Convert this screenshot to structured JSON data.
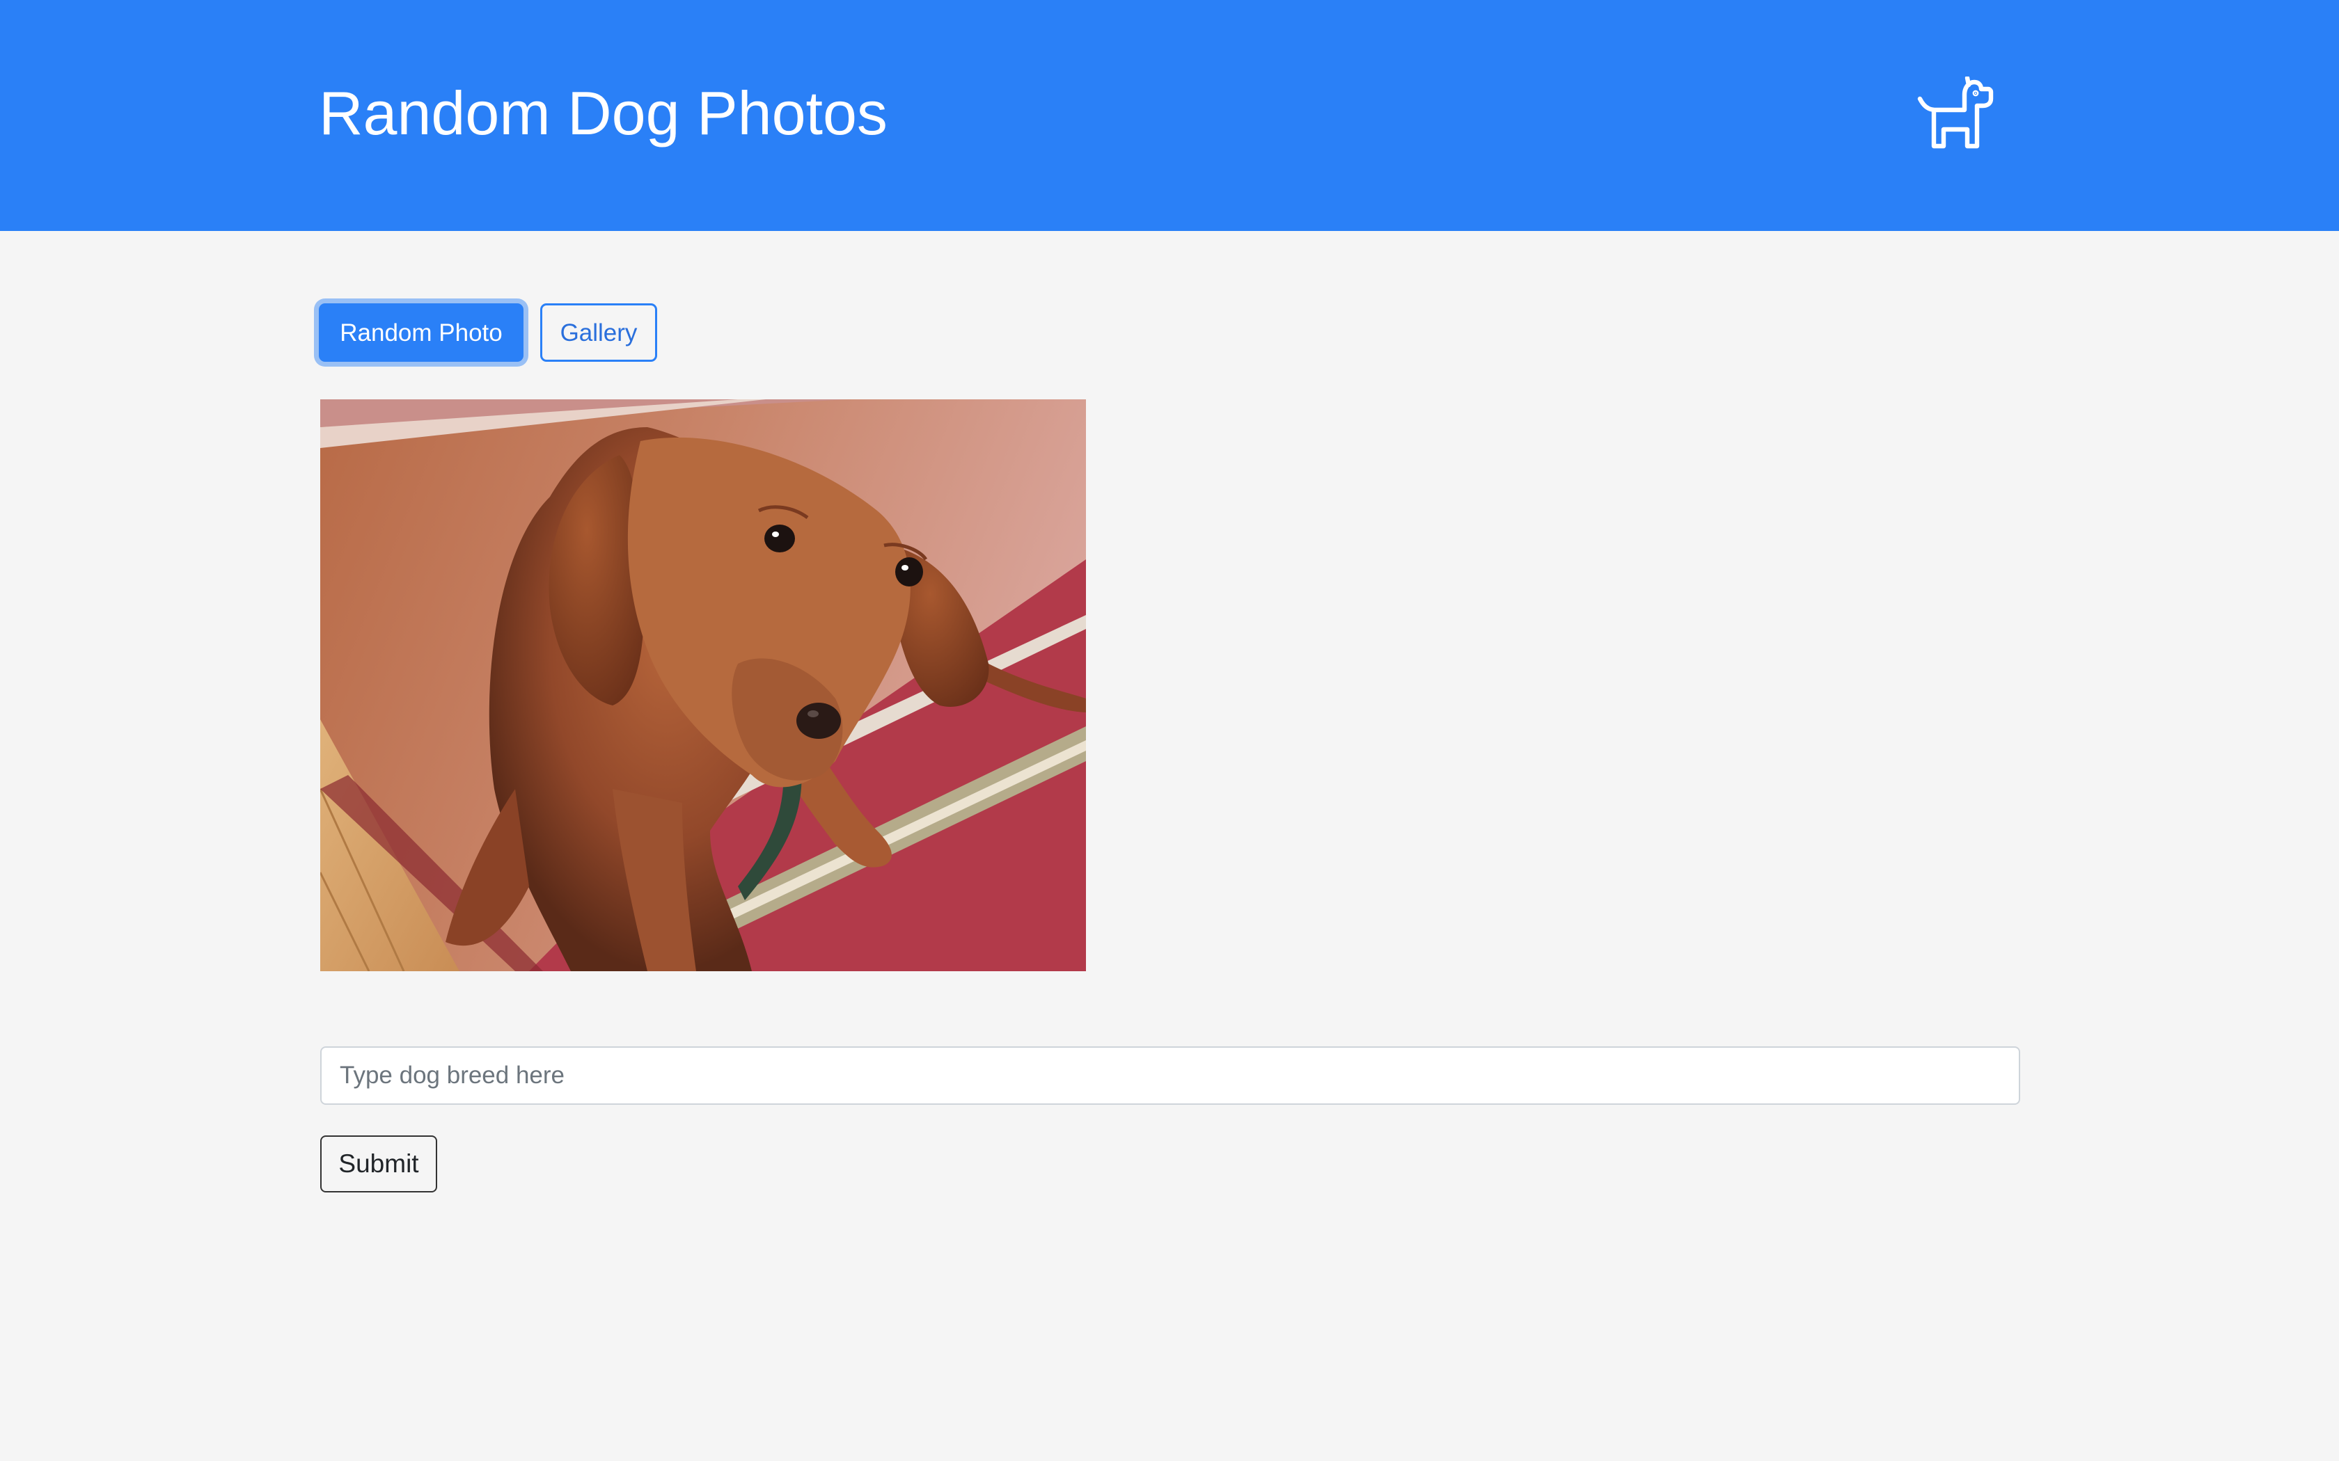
{
  "header": {
    "title": "Random Dog Photos",
    "logo_icon": "dog-icon",
    "background_color": "#2a80f7"
  },
  "tabs": {
    "random_label": "Random Photo",
    "gallery_label": "Gallery",
    "active": "Random Photo"
  },
  "photo": {
    "alt": "Dog photo"
  },
  "search": {
    "placeholder": "Type dog breed here",
    "value": ""
  },
  "form": {
    "submit_label": "Submit"
  },
  "colors": {
    "accent": "#2a80f7",
    "page_background": "#f5f5f5"
  }
}
